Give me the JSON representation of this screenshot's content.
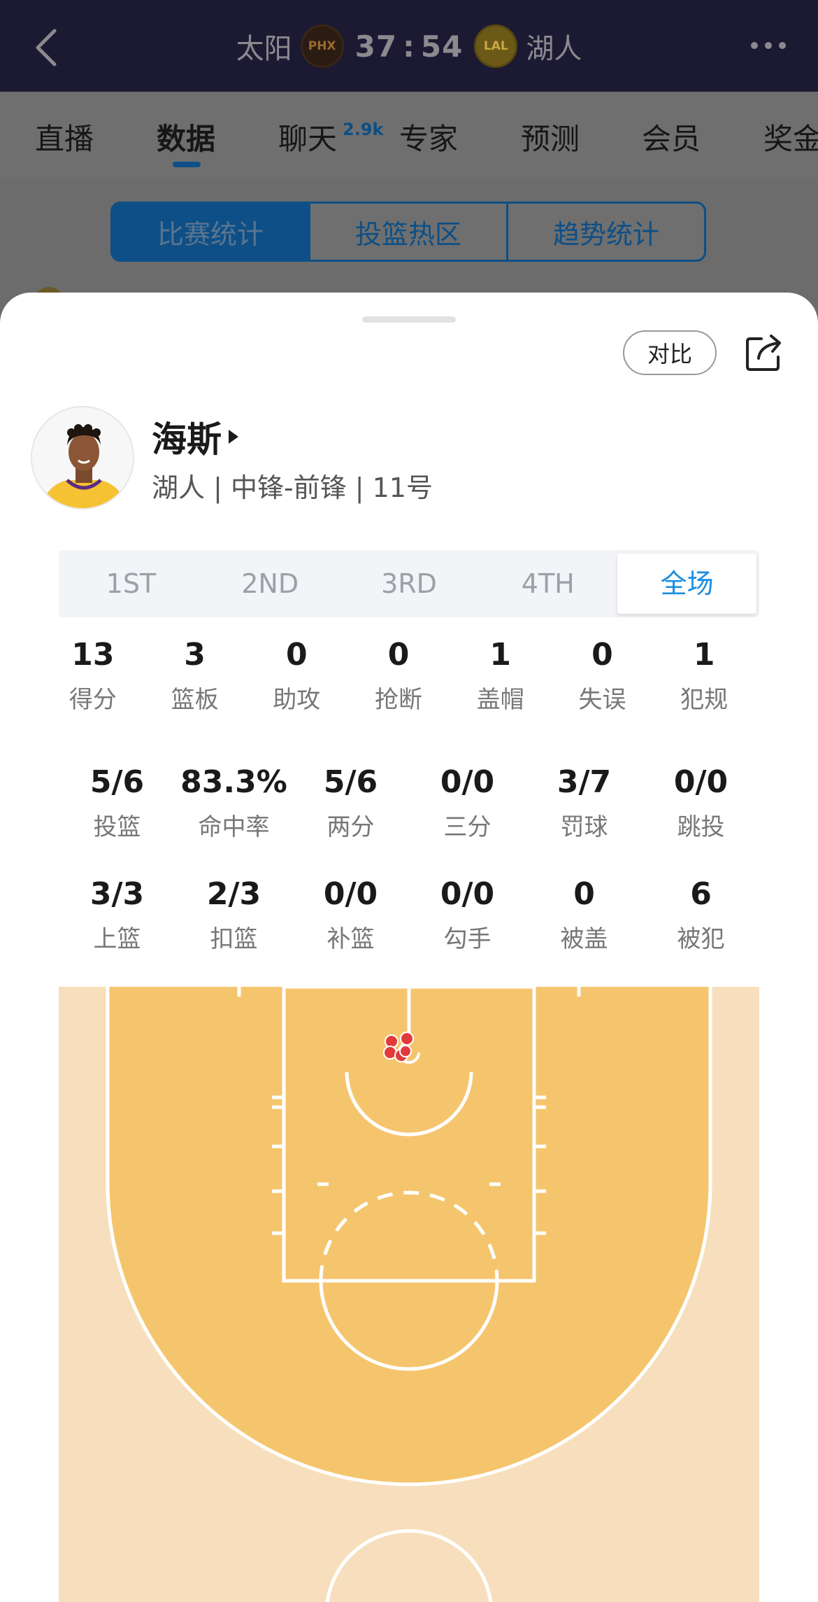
{
  "header": {
    "home_team": "太阳",
    "home_logo": "PHX",
    "home_score": "37",
    "separator": ":",
    "away_score": "54",
    "away_logo": "LAL",
    "away_team": "湖人"
  },
  "tabs": [
    {
      "label": "直播"
    },
    {
      "label": "数据"
    },
    {
      "label": "聊天"
    },
    {
      "label": "专家"
    },
    {
      "label": "预测"
    },
    {
      "label": "会员"
    },
    {
      "label": "奖金"
    }
  ],
  "chat_badge": "2.9k",
  "segments": [
    "比赛统计",
    "投篮热区",
    "趋势统计"
  ],
  "sheet": {
    "compare_label": "对比",
    "player_name": "海斯",
    "player_meta": "湖人 | 中锋-前锋 | 11号",
    "periods": [
      "1ST",
      "2ND",
      "3RD",
      "4TH",
      "全场"
    ],
    "active_period": "全场"
  },
  "stats_row1": [
    {
      "value": "13",
      "label": "得分"
    },
    {
      "value": "3",
      "label": "篮板"
    },
    {
      "value": "0",
      "label": "助攻"
    },
    {
      "value": "0",
      "label": "抢断"
    },
    {
      "value": "1",
      "label": "盖帽"
    },
    {
      "value": "0",
      "label": "失误"
    },
    {
      "value": "1",
      "label": "犯规"
    }
  ],
  "stats_row2": [
    {
      "value": "5/6",
      "label": "投篮"
    },
    {
      "value": "83.3%",
      "label": "命中率"
    },
    {
      "value": "5/6",
      "label": "两分"
    },
    {
      "value": "0/0",
      "label": "三分"
    },
    {
      "value": "3/7",
      "label": "罚球"
    },
    {
      "value": "0/0",
      "label": "跳投"
    }
  ],
  "stats_row3": [
    {
      "value": "3/3",
      "label": "上篮"
    },
    {
      "value": "2/3",
      "label": "扣篮"
    },
    {
      "value": "0/0",
      "label": "补篮"
    },
    {
      "value": "0/0",
      "label": "勾手"
    },
    {
      "value": "0",
      "label": "被盖"
    },
    {
      "value": "6",
      "label": "被犯"
    }
  ],
  "colors": {
    "accent": "#1a8de0",
    "court_paint": "#f5c56d",
    "court_outer": "#f7dfbd",
    "shot_made": "#e23a3a"
  }
}
